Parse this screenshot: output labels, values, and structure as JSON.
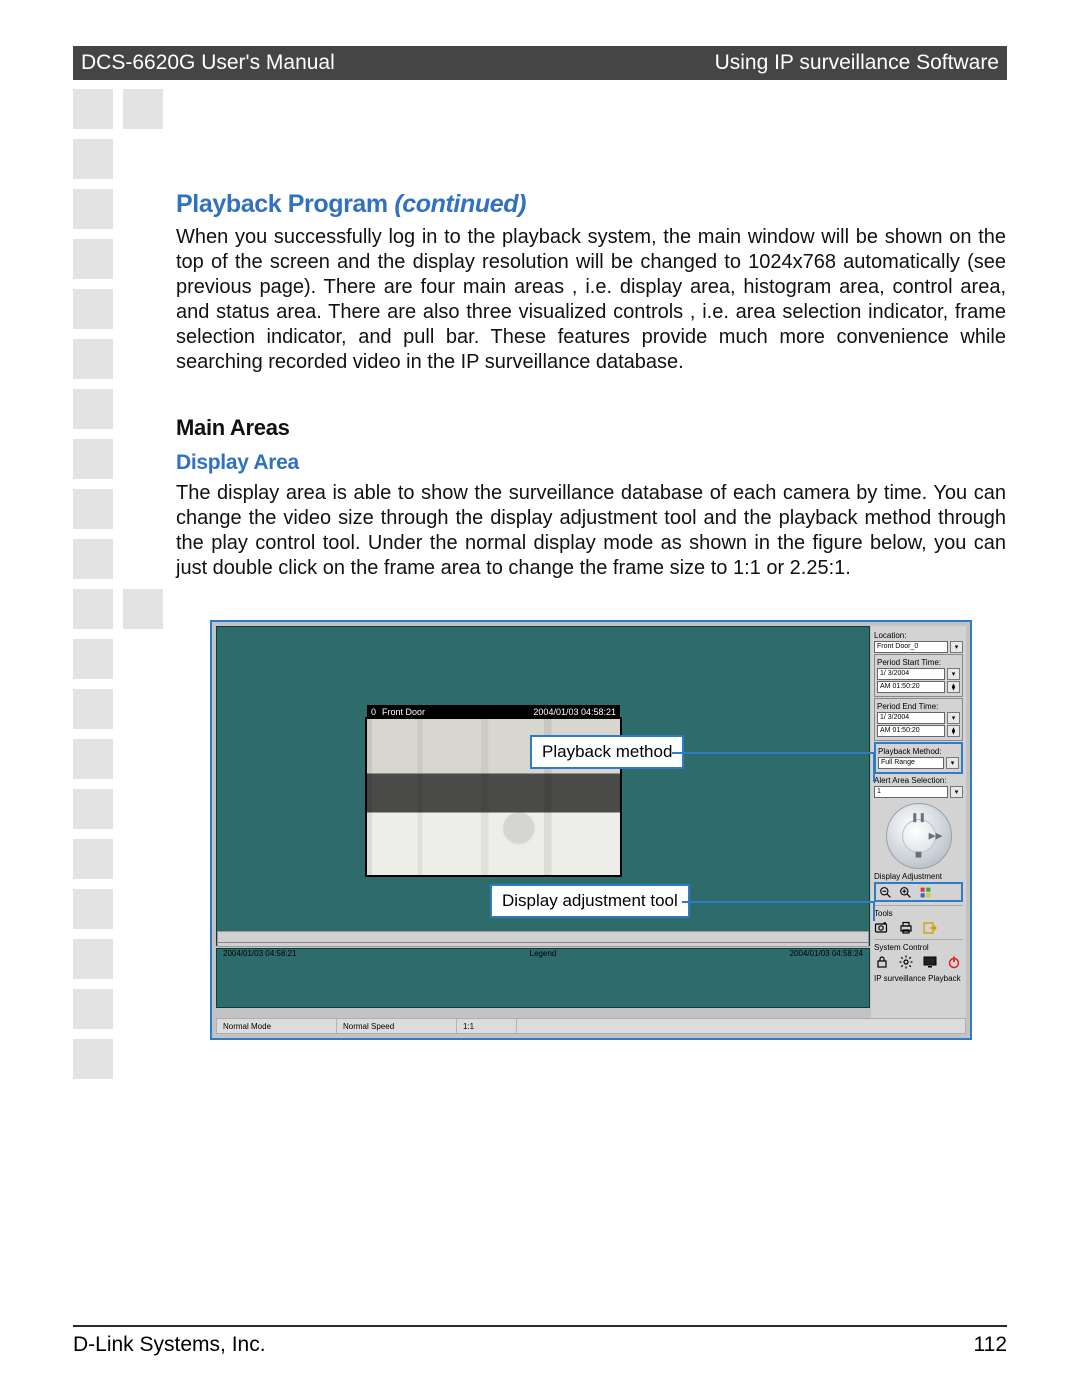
{
  "header": {
    "left": "DCS-6620G User's Manual",
    "right": "Using IP surveillance Software"
  },
  "headings": {
    "playback": "Playback Program",
    "playback_cont": "(continued)",
    "main_areas": "Main Areas",
    "display_area": "Display Area"
  },
  "paragraphs": {
    "intro": "When you successfully log in to the playback system, the main window will be shown on the top of the screen and the display resolution will be changed to 1024x768 automatically (see previous page). There are four main areas , i.e. display area, histogram area, control area, and status area. There are also three visualized controls , i.e. area selection indicator, frame selection indicator, and pull bar. These features provide much more convenience while searching recorded video in the IP surveillance database.",
    "display": "The display area is able to show the surveillance database of each camera by time. You can change the video size through the display adjustment tool and the playback method through the play control tool. Under the normal display mode as shown in the figure below, you can just double click on the frame area to change the frame size to 1:1 or 2.25:1."
  },
  "shot": {
    "video": {
      "camera_index": "0",
      "camera_name": "Front Door",
      "timestamp": "2004/01/03 04:58:21"
    },
    "panel": {
      "location_label": "Location:",
      "location_value": "Front Door_0",
      "period_start_label": "Period Start Time:",
      "period_start_date": "1/ 3/2004",
      "period_start_time": "AM 01:50:20",
      "period_end_label": "Period End Time:",
      "period_end_date": "1/ 3/2004",
      "period_end_time": "AM 01:50:20",
      "playback_method_label": "Playback Method:",
      "playback_method_value": "Full Range",
      "alert_area_label": "Alert Area Selection:",
      "alert_area_value": "1",
      "display_adj_label": "Display Adjustment",
      "tools_label": "Tools",
      "system_control_label": "System Control",
      "footer": "IP surveillance Playback"
    },
    "timeline": {
      "left": "2004/01/03 04:58:21",
      "legend": "Legend",
      "right": "2004/01/03 04:58:24"
    },
    "status": {
      "mode": "Normal Mode",
      "speed": "Normal Speed",
      "ratio": "1:1",
      "right": ""
    },
    "callouts": {
      "playback_method": "Playback method",
      "display_adjustment": "Display adjustment tool"
    }
  },
  "footer": {
    "company": "D-Link Systems, Inc.",
    "page": "112"
  }
}
